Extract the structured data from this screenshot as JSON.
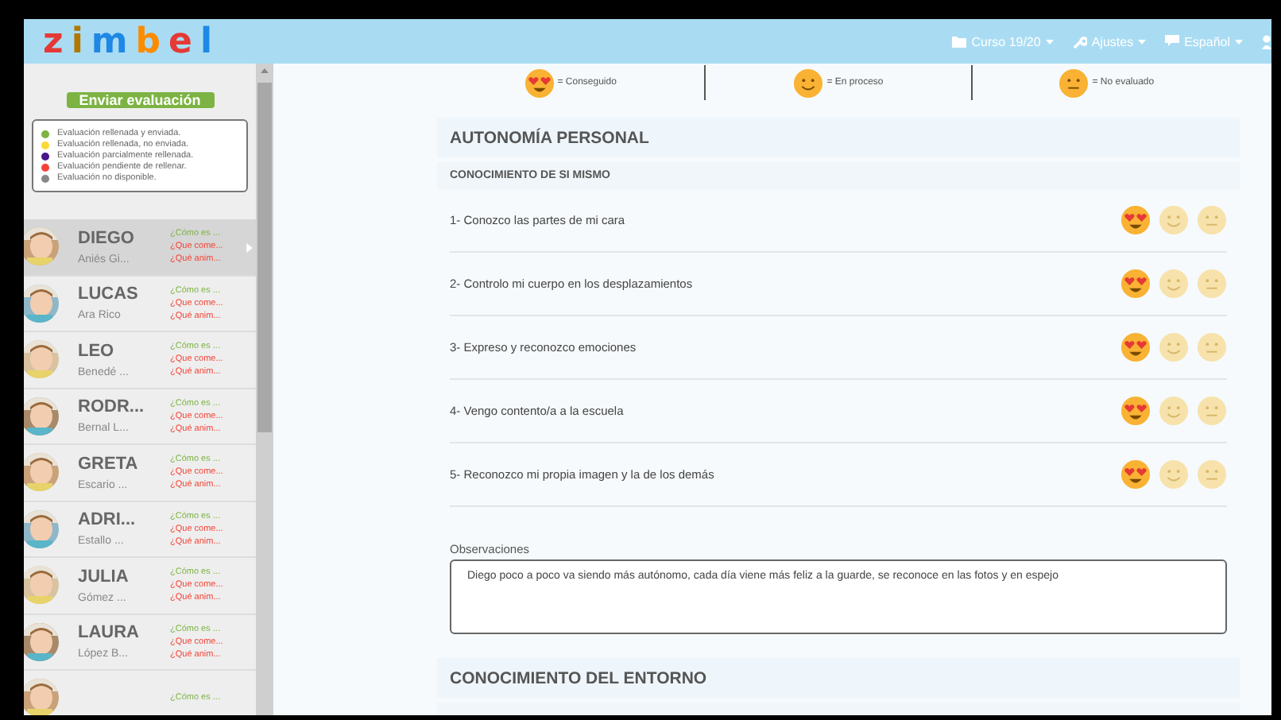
{
  "header": {
    "logo": "zimbel",
    "menu": [
      {
        "kind": "folder",
        "label": "Curso 19/20"
      },
      {
        "kind": "wrench",
        "label": "Ajustes"
      },
      {
        "kind": "chat",
        "label": "Español"
      },
      {
        "kind": "user"
      }
    ]
  },
  "sidebar": {
    "send_button": "Enviar evaluación",
    "legend": [
      {
        "label": "Evaluación rellenada y enviada.",
        "color": "#7cb342"
      },
      {
        "label": "Evaluación rellenada, no enviada.",
        "color": "#fdd835"
      },
      {
        "label": "Evaluación parcialmente rellenada.",
        "color": "#4a148c"
      },
      {
        "label": "Evaluación pendiente de rellenar.",
        "color": "#f44336"
      },
      {
        "label": "Evaluación no disponible.",
        "color": "#888888"
      }
    ],
    "students": [
      {
        "name": "DIEGO",
        "surname": "Aniés Gi...",
        "selected": true,
        "links": [
          "¿Cómo es ...",
          "¿Que come...",
          "¿Qué anim..."
        ]
      },
      {
        "name": "LUCAS",
        "surname": "Ara Rico",
        "selected": false,
        "links": [
          "¿Cómo es ...",
          "¿Que come...",
          "¿Qué anim..."
        ]
      },
      {
        "name": "LEO",
        "surname": "Benedé ...",
        "selected": false,
        "links": [
          "¿Cómo es ...",
          "¿Que come...",
          "¿Qué anim..."
        ]
      },
      {
        "name": "RODR...",
        "surname": "Bernal L...",
        "selected": false,
        "links": [
          "¿Cómo es ...",
          "¿Que come...",
          "¿Qué anim..."
        ]
      },
      {
        "name": "GRETA",
        "surname": "Escario ...",
        "selected": false,
        "links": [
          "¿Cómo es ...",
          "¿Que come...",
          "¿Qué anim..."
        ]
      },
      {
        "name": "ADRI...",
        "surname": "Estallo ...",
        "selected": false,
        "links": [
          "¿Cómo es ...",
          "¿Que come...",
          "¿Qué anim..."
        ]
      },
      {
        "name": "JULIA",
        "surname": "Gómez ...",
        "selected": false,
        "links": [
          "¿Cómo es ...",
          "¿Que come...",
          "¿Qué anim..."
        ]
      },
      {
        "name": "LAURA",
        "surname": "López B...",
        "selected": false,
        "links": [
          "¿Cómo es ...",
          "¿Que come...",
          "¿Qué anim..."
        ]
      },
      {
        "selected": false,
        "links": [
          "¿Cómo es ..."
        ]
      }
    ]
  },
  "rating_legend": [
    {
      "kind": "loved",
      "label": "= Conseguido"
    },
    {
      "kind": "smile",
      "label": "= En proceso"
    },
    {
      "kind": "neutral",
      "label": "= No evaluado"
    }
  ],
  "sections": [
    {
      "title": "AUTONOMÍA PERSONAL",
      "subtitle": "CONOCIMIENTO DE SI MISMO",
      "items": [
        {
          "label": "1- Conozco las partes de mi cara",
          "options": [
            {
              "kind": "loved",
              "selected": true
            },
            {
              "kind": "smile",
              "selected": false
            },
            {
              "kind": "neutral",
              "selected": false
            }
          ]
        },
        {
          "label": "2- Controlo mi cuerpo en los desplazamientos",
          "options": [
            {
              "kind": "loved",
              "selected": true
            },
            {
              "kind": "smile",
              "selected": false
            },
            {
              "kind": "neutral",
              "selected": false
            }
          ]
        },
        {
          "label": "3- Expreso y reconozco emociones",
          "options": [
            {
              "kind": "loved",
              "selected": true
            },
            {
              "kind": "smile",
              "selected": false
            },
            {
              "kind": "neutral",
              "selected": false
            }
          ]
        },
        {
          "label": "4- Vengo contento/a a la escuela",
          "options": [
            {
              "kind": "loved",
              "selected": true
            },
            {
              "kind": "smile",
              "selected": false
            },
            {
              "kind": "neutral",
              "selected": false
            }
          ]
        },
        {
          "label": "5- Reconozco mi propia imagen y la de los demás",
          "options": [
            {
              "kind": "loved",
              "selected": true
            },
            {
              "kind": "smile",
              "selected": false
            },
            {
              "kind": "neutral",
              "selected": false
            }
          ]
        }
      ],
      "notes_label": "Observaciones",
      "notes": "Diego poco a poco va siendo más autónomo, cada día viene más feliz a la guarde, se reconoce en las fotos y en espejo"
    },
    {
      "title": "CONOCIMIENTO DEL ENTORNO"
    }
  ]
}
